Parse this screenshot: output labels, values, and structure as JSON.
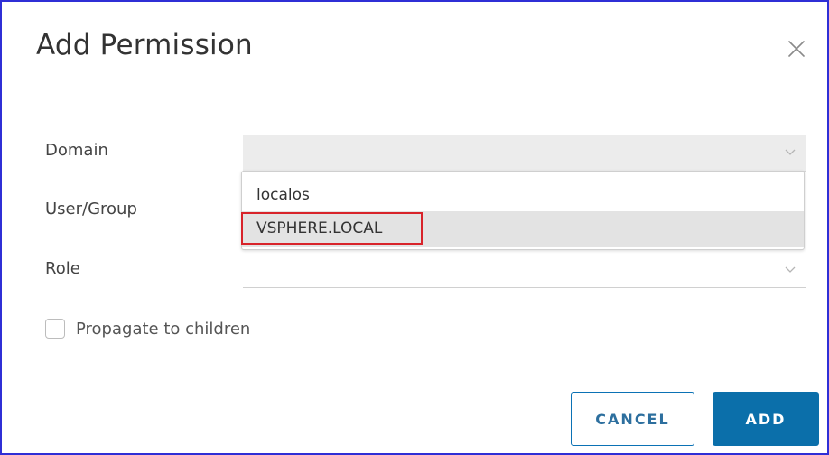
{
  "dialog": {
    "title": "Add Permission",
    "close_icon": "close-icon"
  },
  "form": {
    "domain_label": "Domain",
    "domain_value": "",
    "user_group_label": "User/Group",
    "role_label": "Role",
    "role_value": "",
    "propagate_label": "Propagate to children",
    "propagate_checked": false
  },
  "domain_dropdown": {
    "options": [
      "localos",
      "VSPHERE.LOCAL"
    ],
    "highlighted_index": 1
  },
  "buttons": {
    "cancel_label": "CANCEL",
    "add_label": "ADD"
  },
  "colors": {
    "frame_border": "#2f2fd6",
    "highlight_box": "#d8232a",
    "primary_button": "#0b6faa",
    "secondary_button_border": "#0b72b5"
  }
}
